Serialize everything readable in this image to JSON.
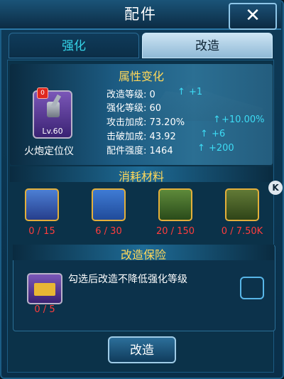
{
  "window": {
    "title": "配件",
    "close_label": "✕"
  },
  "tabs": [
    {
      "label": "强化",
      "active": false
    },
    {
      "label": "改造",
      "active": true
    }
  ],
  "attributes": {
    "section_title": "属性变化",
    "item": {
      "name": "火炮定位仪",
      "level": "Lv.60",
      "badge": "0"
    },
    "rows": [
      {
        "label": "改造等级: 0",
        "arrow": "↑",
        "inc": "+1"
      },
      {
        "label": "强化等级: 60",
        "arrow": "",
        "inc": ""
      },
      {
        "label": "攻击加成: 73.20%",
        "arrow": "↑",
        "inc": "+10.00%"
      },
      {
        "label": "击破加成: 43.92",
        "arrow": "↑",
        "inc": "+6"
      },
      {
        "label": "配件强度: 1464",
        "arrow": "↑",
        "inc": "+200"
      }
    ]
  },
  "materials": {
    "section_title": "消耗材料",
    "items": [
      {
        "icon": "blueprint-card-icon",
        "count": "0 / 15"
      },
      {
        "icon": "ore-crystal-icon",
        "count": "6 / 30"
      },
      {
        "icon": "wrench-icon",
        "count": "20 / 150"
      },
      {
        "icon": "gear-part-icon",
        "count": "0 / 7.50K"
      }
    ]
  },
  "insurance": {
    "section_title": "改造保险",
    "item_count": "0 / 5",
    "description": "勾选后改造不降低强化等级"
  },
  "actions": {
    "upgrade_label": "改造"
  },
  "side_badge": "K"
}
